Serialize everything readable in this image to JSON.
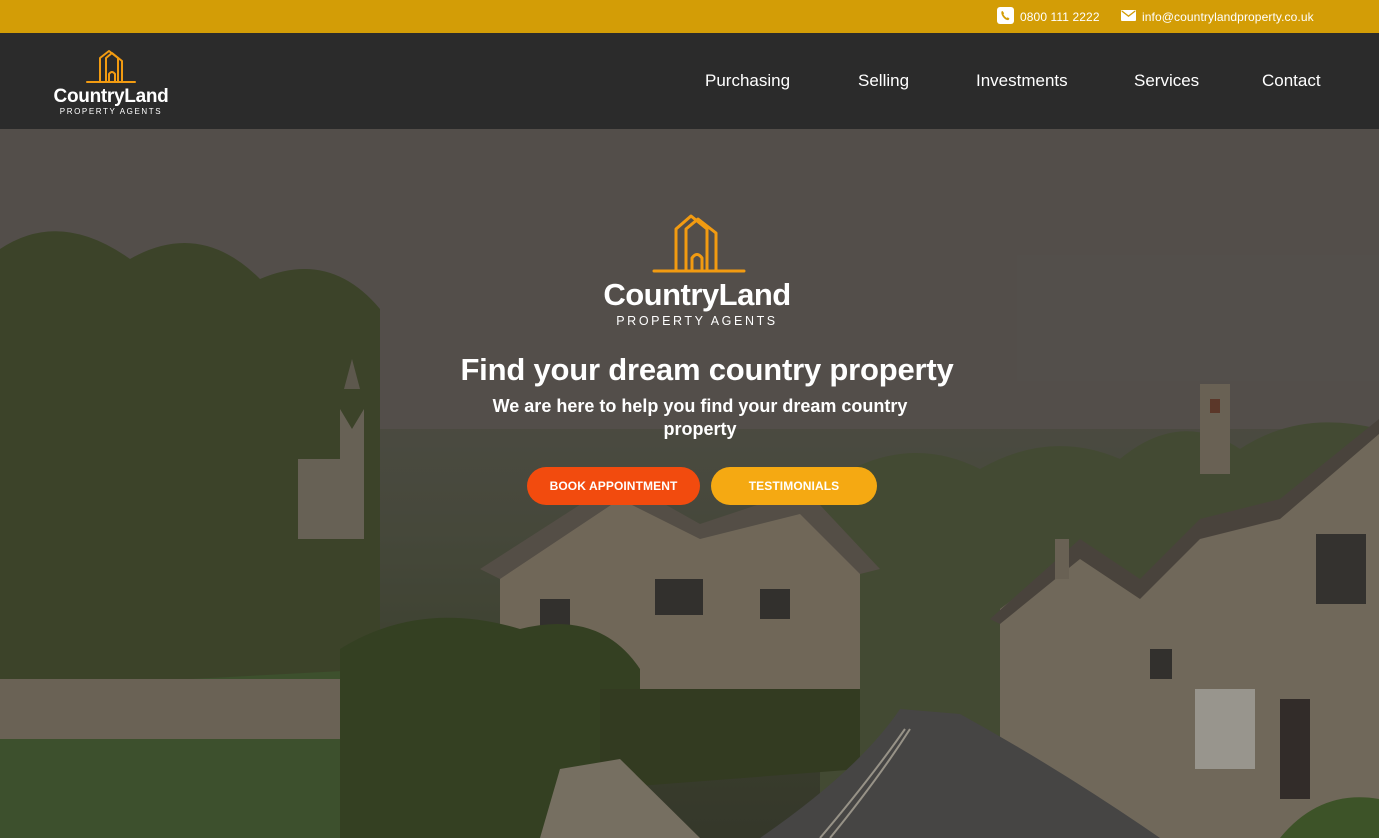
{
  "topbar": {
    "phone": "0800 111 2222",
    "email": "info@countrylandproperty.co.uk",
    "phone_icon": "phone-icon",
    "email_icon": "envelope-icon"
  },
  "header": {
    "logo": {
      "brand": "CountryLand",
      "sub": "PROPERTY AGENTS"
    },
    "nav": [
      "Purchasing",
      "Selling",
      "Investments",
      "Services",
      "Contact"
    ]
  },
  "hero": {
    "logo": {
      "brand": "CountryLand",
      "sub": "PROPERTY AGENTS"
    },
    "headline": "Find your dream country property",
    "subline": "We are here to help you find your dream country property",
    "buttons": {
      "book": "BOOK APPOINTMENT",
      "testimonials": "TESTIMONIALS"
    }
  },
  "colors": {
    "topbar": "#d39d06",
    "header": "#2b2b2b",
    "logo_accent": "#f29b11",
    "book_button": "#f24b0e",
    "testimonials_button": "#f5a912"
  }
}
